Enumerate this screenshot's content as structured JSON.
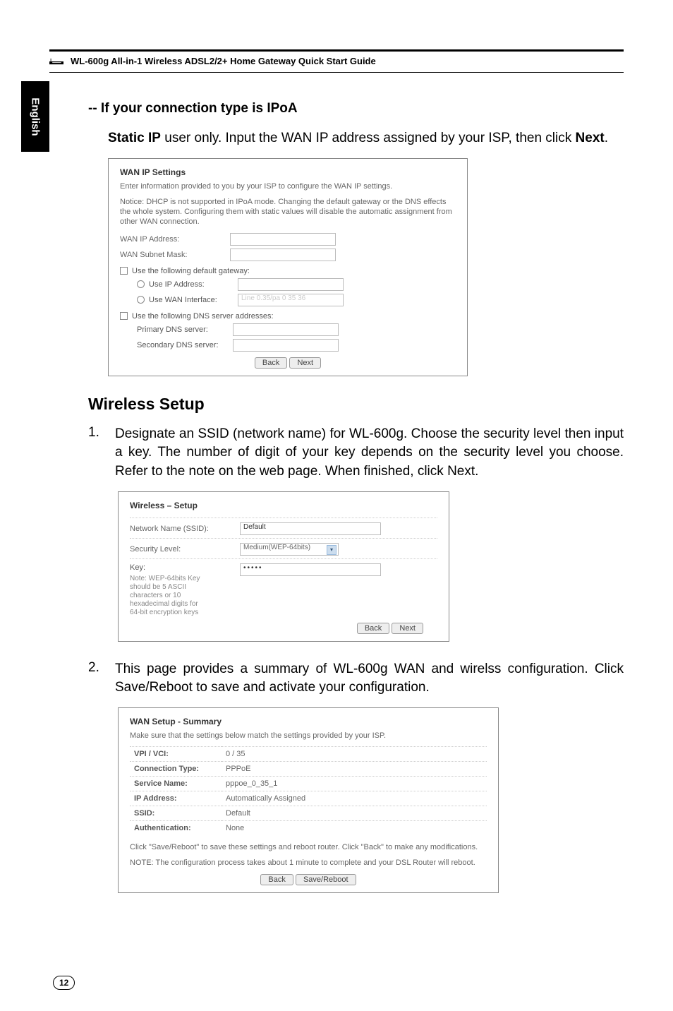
{
  "header": {
    "product_title": "WL-600g All-in-1 Wireless ADSL2/2+ Home Gateway Quick Start Guide"
  },
  "lang_tab": "English",
  "section_ipoa": {
    "heading": "-- If your connection type is IPoA",
    "intro_bold1": "Static IP",
    "intro_mid": " user only. Input the WAN IP address assigned by your ISP, then click ",
    "intro_bold2": "Next",
    "intro_tail": "."
  },
  "shot1": {
    "title": "WAN IP Settings",
    "desc1": "Enter information provided to you by your ISP to configure the WAN IP settings.",
    "desc2": "Notice: DHCP is not supported in IPoA mode. Changing the default gateway or the DNS effects the whole system. Configuring them with static values will disable the automatic assignment from other WAN connection.",
    "row_wanip": "WAN IP Address:",
    "row_mask": "WAN Subnet Mask:",
    "chk_gw": "Use the following default gateway:",
    "sub_useip": "Use IP Address:",
    "sub_usewan": "Use WAN Interface:",
    "sub_usewan_val": "Line 0.35/pa 0 35 36",
    "chk_dns": "Use the following DNS server addresses:",
    "sub_pdns": "Primary DNS server:",
    "sub_sdns": "Secondary DNS server:",
    "btn_back": "Back",
    "btn_next": "Next"
  },
  "section_wireless": {
    "heading": "Wireless Setup",
    "li1_pre": "Designate an SSID (network name) for WL-600g. Choose the security level then input a key. The number of digit of your key depends on the security level you choose. Refer to the note on the web page. When finished, click ",
    "li1_bold": "Next",
    "li1_tail": ".",
    "li2_pre": "This page provides a summary of WL-600g WAN and wirelss configuration. Click ",
    "li2_bold": "Save/Reboot",
    "li2_tail": " to save and activate your configuration."
  },
  "shot2": {
    "title": "Wireless – Setup",
    "row_ssid": "Network Name (SSID):",
    "row_ssid_val": "Default",
    "row_sec": "Security Level:",
    "row_sec_val": "Medium(WEP-64bits)",
    "row_key": "Key:",
    "row_key_val": "•••••",
    "note": "Note: WEP-64bits Key should be 5 ASCII characters or 10 hexadecimal digits for 64-bit encryption keys",
    "btn_back": "Back",
    "btn_next": "Next"
  },
  "shot3": {
    "title": "WAN Setup - Summary",
    "desc": "Make sure that the settings below match the settings provided by your ISP.",
    "rows": [
      {
        "k": "VPI / VCI:",
        "v": "0 / 35"
      },
      {
        "k": "Connection Type:",
        "v": "PPPoE"
      },
      {
        "k": "Service Name:",
        "v": "pppoe_0_35_1"
      },
      {
        "k": "IP Address:",
        "v": "Automatically Assigned"
      },
      {
        "k": "SSID:",
        "v": "Default"
      },
      {
        "k": "Authentication:",
        "v": "None"
      }
    ],
    "foot1": "Click \"Save/Reboot\" to save these settings and reboot router. Click \"Back\" to make any modifications.",
    "foot2": "NOTE: The configuration process takes about 1 minute to complete and your DSL Router will reboot.",
    "btn_back": "Back",
    "btn_save": "Save/Reboot"
  },
  "page_number": "12"
}
